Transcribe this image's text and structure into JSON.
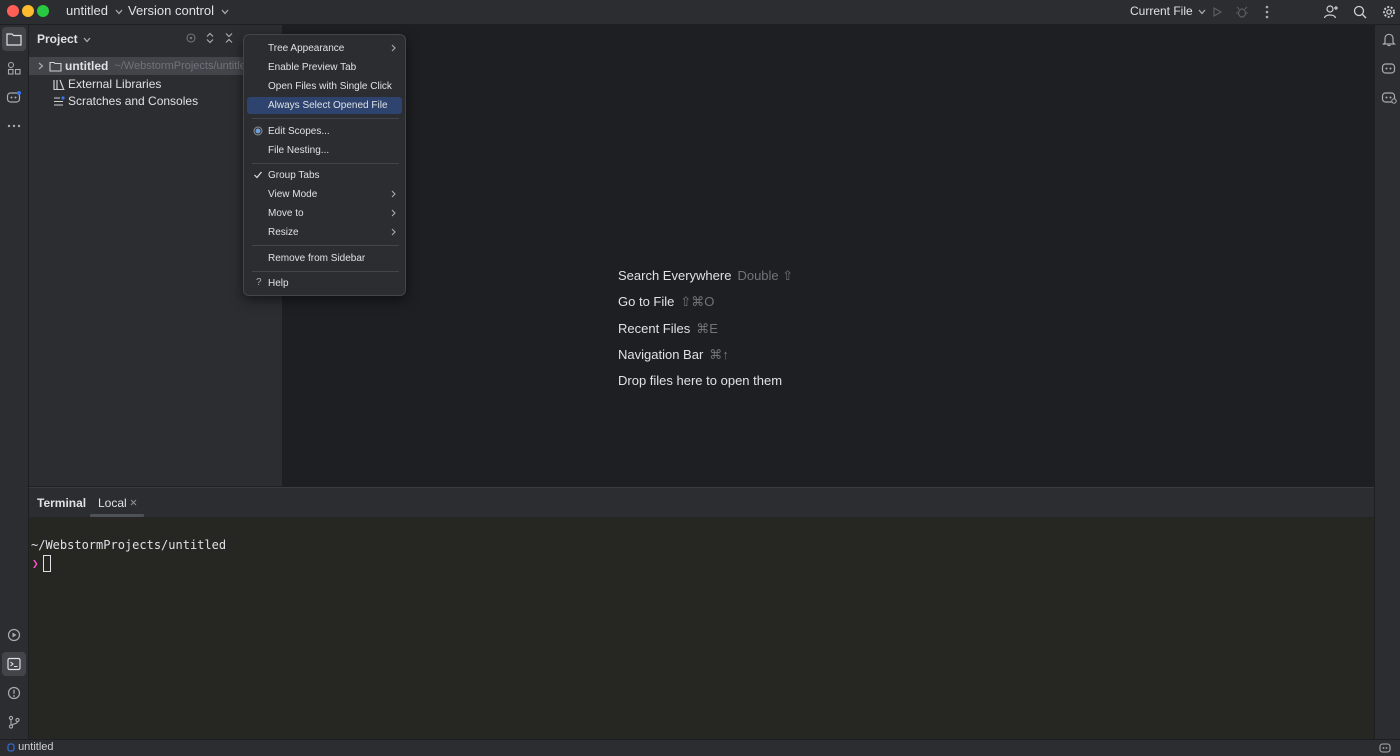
{
  "titlebar": {
    "project": "untitled",
    "vcs": "Version control",
    "run_config": "Current File",
    "traffic_colors": {
      "close": "#ff5f57",
      "minimize": "#febc2e",
      "zoom": "#28c840"
    }
  },
  "project_panel": {
    "title": "Project",
    "tree": [
      {
        "label": "untitled",
        "path": "~/WebstormProjects/untitled"
      },
      {
        "label": "External Libraries"
      },
      {
        "label": "Scratches and Consoles"
      }
    ]
  },
  "context_menu": {
    "items": {
      "tree_appearance": "Tree Appearance",
      "enable_preview_tab": "Enable Preview Tab",
      "open_single_click": "Open Files with Single Click",
      "always_select_opened": "Always Select Opened File",
      "edit_scopes": "Edit Scopes...",
      "file_nesting": "File Nesting...",
      "group_tabs": "Group Tabs",
      "view_mode": "View Mode",
      "move_to": "Move to",
      "resize": "Resize",
      "remove_sidebar": "Remove from Sidebar",
      "help": "Help"
    },
    "selected": "Always Select Opened File"
  },
  "editor": {
    "hints": [
      {
        "label": "Search Everywhere",
        "shortcut": "Double ⇧"
      },
      {
        "label": "Go to File",
        "shortcut": "⇧⌘O"
      },
      {
        "label": "Recent Files",
        "shortcut": "⌘E"
      },
      {
        "label": "Navigation Bar",
        "shortcut": "⌘↑"
      },
      {
        "label": "Drop files here to open them",
        "shortcut": ""
      }
    ]
  },
  "terminal": {
    "title": "Terminal",
    "tab": "Local",
    "cwd": "~/WebstormProjects/untitled",
    "prompt": "❯"
  },
  "statusbar": {
    "project": "untitled"
  },
  "colors": {
    "accent": "#3574f0",
    "menu_selection": "#2e436e",
    "prompt": "#ff4fc8"
  }
}
